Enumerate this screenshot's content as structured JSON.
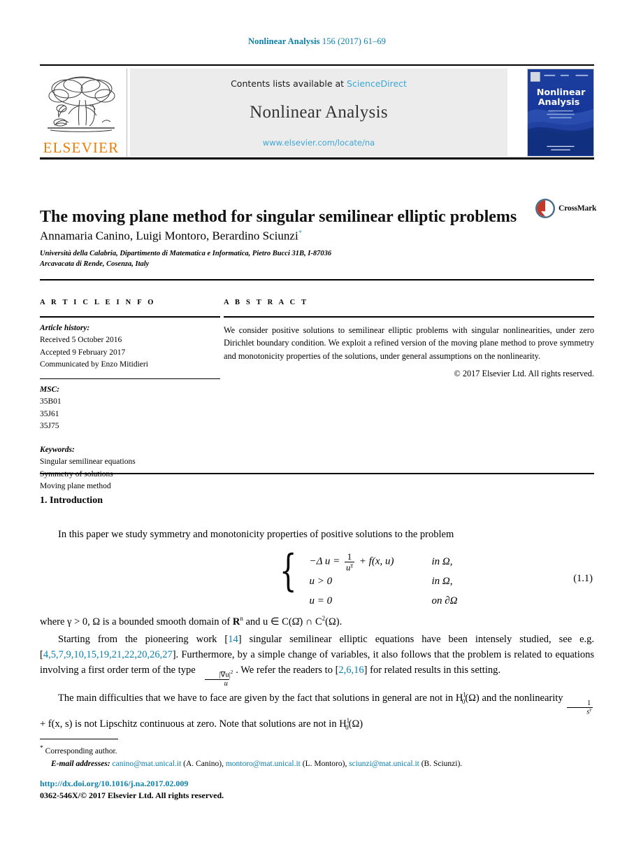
{
  "running_head": {
    "journal": "Nonlinear Analysis",
    "volume_info": "156 (2017) 61–69"
  },
  "masthead": {
    "publisher": "ELSEVIER",
    "contents_prefix": "Contents lists available at ",
    "contents_link": "ScienceDirect",
    "journal_title": "Nonlinear Analysis",
    "journal_url": "www.elsevier.com/locate/na",
    "cover_title_line1": "Nonlinear",
    "cover_title_line2": "Analysis",
    "colors": {
      "link": "#3ba6d6",
      "orange": "#ef7d00",
      "panel": "#ececec",
      "cover": "#16399c"
    }
  },
  "article": {
    "title": "The moving plane method for singular semilinear elliptic problems",
    "authors": "Annamaria Canino, Luigi Montoro, Berardino Sciunzi",
    "author_marker": "*",
    "affiliation_line1": "Università della Calabria, Dipartimento di Matematica e Informatica, Pietro Bucci 31B, I-87036",
    "affiliation_line2": "Arcavacata di Rende, Cosenza, Italy",
    "crossmark_label": "CrossMark"
  },
  "info": {
    "heading": "A R T I C L E   I N F O",
    "history_label": "Article history:",
    "received": "Received 5 October 2016",
    "accepted": "Accepted 9 February 2017",
    "communicated": "Communicated by Enzo Mitidieri",
    "msc_label": "MSC:",
    "msc": [
      "35B01",
      "35J61",
      "35J75"
    ],
    "keywords_label": "Keywords:",
    "keywords": [
      "Singular semilinear equations",
      "Symmetry of solutions",
      "Moving plane method"
    ]
  },
  "abstract": {
    "heading": "A B S T R A C T",
    "text": "We consider positive solutions to semilinear elliptic problems with singular nonlinearities, under zero Dirichlet boundary condition. We exploit a refined version of the moving plane method to prove symmetry and monotonicity properties of the solutions, under general assumptions on the nonlinearity.",
    "copyright": "© 2017 Elsevier Ltd. All rights reserved."
  },
  "body": {
    "section_number_title": "1. Introduction",
    "p1": "In this paper we study symmetry and monotonicity properties of positive solutions to the problem",
    "equation": {
      "number": "(1.1)",
      "row1_left_pre": "−Δ u =",
      "row1_frac_num": "1",
      "row1_frac_den": "u",
      "row1_frac_den_exp": "γ",
      "row1_left_post": "+ f(x, u)",
      "row1_right": "in Ω,",
      "row2_left": "u > 0",
      "row2_right": "in Ω,",
      "row3_left": "u = 0",
      "row3_right": "on ∂Ω"
    },
    "p2_a": "where γ > 0, Ω is a bounded smooth domain of ",
    "p2_rn": "R",
    "p2_rn_exp": "n",
    "p2_b": " and u ∈ C(Ω̄) ∩ C",
    "p2_c2": "2",
    "p2_d": "(Ω).",
    "p3_a": "Starting from the pioneering work [",
    "p3_cite1": "14",
    "p3_b": "] singular semilinear elliptic equations have been intensely studied, see e.g. [",
    "p3_cites": "4,5,7,9,10,15,19,21,22,20,26,27",
    "p3_c": "]. Furthermore, by a simple change of variables, it also follows that the problem is related to equations involving a first order term of the type ",
    "p3_frac_num": "|∇u|",
    "p3_frac_num_exp": "2",
    "p3_frac_den": "u",
    "p3_d": ". We refer the readers to [",
    "p3_cites2": "2,6,16",
    "p3_e": "] for related results in this setting.",
    "p4_a": "The main difficulties that we have to face are given by the fact that solutions in general are not in H",
    "p4_sub": "0",
    "p4_sup": "1",
    "p4_b": "(Ω) and the nonlinearity ",
    "p4_frac_num": "1",
    "p4_frac_den": "s",
    "p4_frac_den_exp": "γ",
    "p4_c": " + f(x, s) is not Lipschitz continuous at zero. Note that solutions are not in H",
    "p4_d": "(Ω)"
  },
  "footnotes": {
    "corresponding_marker": "*",
    "corresponding": "Corresponding author.",
    "email_label": "E-mail addresses:",
    "emails": [
      {
        "address": "canino@mat.unical.it",
        "person": "(A. Canino)"
      },
      {
        "address": "montoro@mat.unical.it",
        "person": "(L. Montoro)"
      },
      {
        "address": "sciunzi@mat.unical.it",
        "person": "(B. Sciunzi)"
      }
    ]
  },
  "footer": {
    "doi": "http://dx.doi.org/10.1016/j.na.2017.02.009",
    "issn_copyright": "0362-546X/© 2017 Elsevier Ltd. All rights reserved."
  }
}
